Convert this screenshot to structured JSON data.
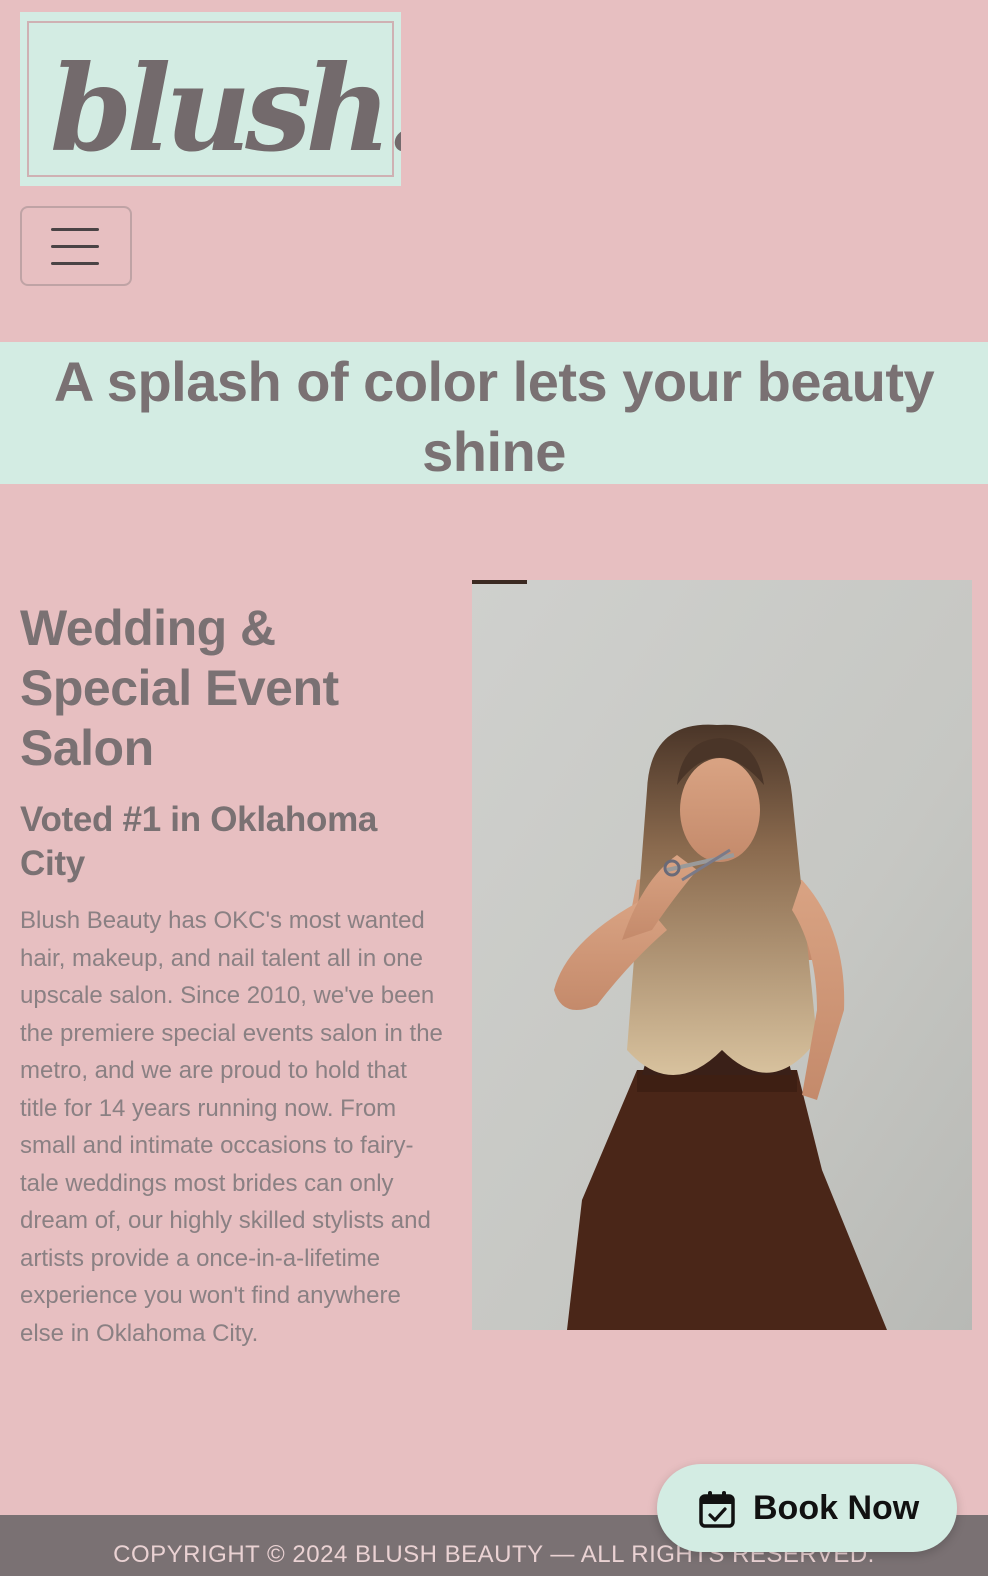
{
  "header": {
    "logo_text": "blush.",
    "logo_icon": "blush-logo",
    "menu_icon": "hamburger-menu-icon"
  },
  "banner": {
    "headline": "A splash of color lets your beauty shine"
  },
  "intro": {
    "title": "Wedding & Special Event Salon",
    "subtitle": "Voted #1 in Oklahoma City",
    "body": "Blush Beauty has OKC's most wanted hair, makeup, and nail talent all in one upscale salon. Since 2010, we've been the premiere special events salon in the metro, and we are proud to hold that title for 14 years running now. From small and intimate occasions to fairy-tale weddings most brides can only dream of, our highly skilled stylists and artists provide a once-in-a-lifetime experience you won't find anywhere else in Oklahoma City."
  },
  "book_button": {
    "label": "Book Now",
    "icon": "calendar-check-icon"
  },
  "footer": {
    "copyright": "COPYRIGHT © 2024 BLUSH BEAUTY — ALL RIGHTS RESERVED."
  },
  "colors": {
    "page_background": "#e7bfc1",
    "accent_mint": "#d3ece3",
    "text_gray": "#7a7173",
    "footer_background": "#7a7173"
  }
}
